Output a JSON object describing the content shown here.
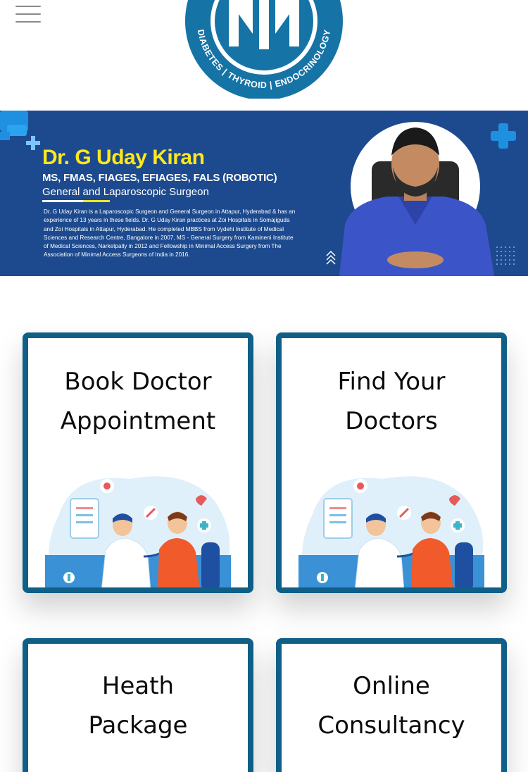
{
  "header": {
    "menu_icon": "hamburger-menu-icon",
    "logo": {
      "letters": "MM",
      "tagline": "DIABETES | THYROID | ENDOCRINOLOGY",
      "color": "#1673a6"
    }
  },
  "banner": {
    "name": "Dr. G Uday Kiran",
    "qualifications": "MS, FMAS, FIAGES, EFIAGES, FALS (ROBOTIC)",
    "role": "General and Laparoscopic Surgeon",
    "bio": "Dr. G Uday Kiran is a Laparoscopic Surgeon and General Surgeon in Attapur, Hyderabad & has an experience of 13 years in these fields. Dr. G Uday Kiran practices at Zoi Hospitals in Somajiguda and Zoi Hospitals in Attapur, Hyderabad. He completed MBBS from Vydehi Institute of Medical Sciences and Research Centre, Bangalore in 2007, MS - General Surgery from Kamineni Institute of Medical Sciences, Narketpally in 2012 and Fellowship in Minimal Access Surgery from The Association of Minimal Access Surgeons of India in 2016.",
    "colors": {
      "background": "#1d4a8e",
      "name": "#ffe81c",
      "accent": "#1f8fe0"
    }
  },
  "cards": [
    {
      "title_line1": "Book Doctor",
      "title_line2": "Appointment",
      "illustration": "doctor-consultation-illustration"
    },
    {
      "title_line1": "Find Your",
      "title_line2": "Doctors",
      "illustration": "doctor-consultation-illustration"
    },
    {
      "title_line1": "Heath",
      "title_line2": "Package"
    },
    {
      "title_line1": "Online",
      "title_line2": "Consultancy"
    }
  ],
  "colors": {
    "card_border": "#0f5f86"
  }
}
